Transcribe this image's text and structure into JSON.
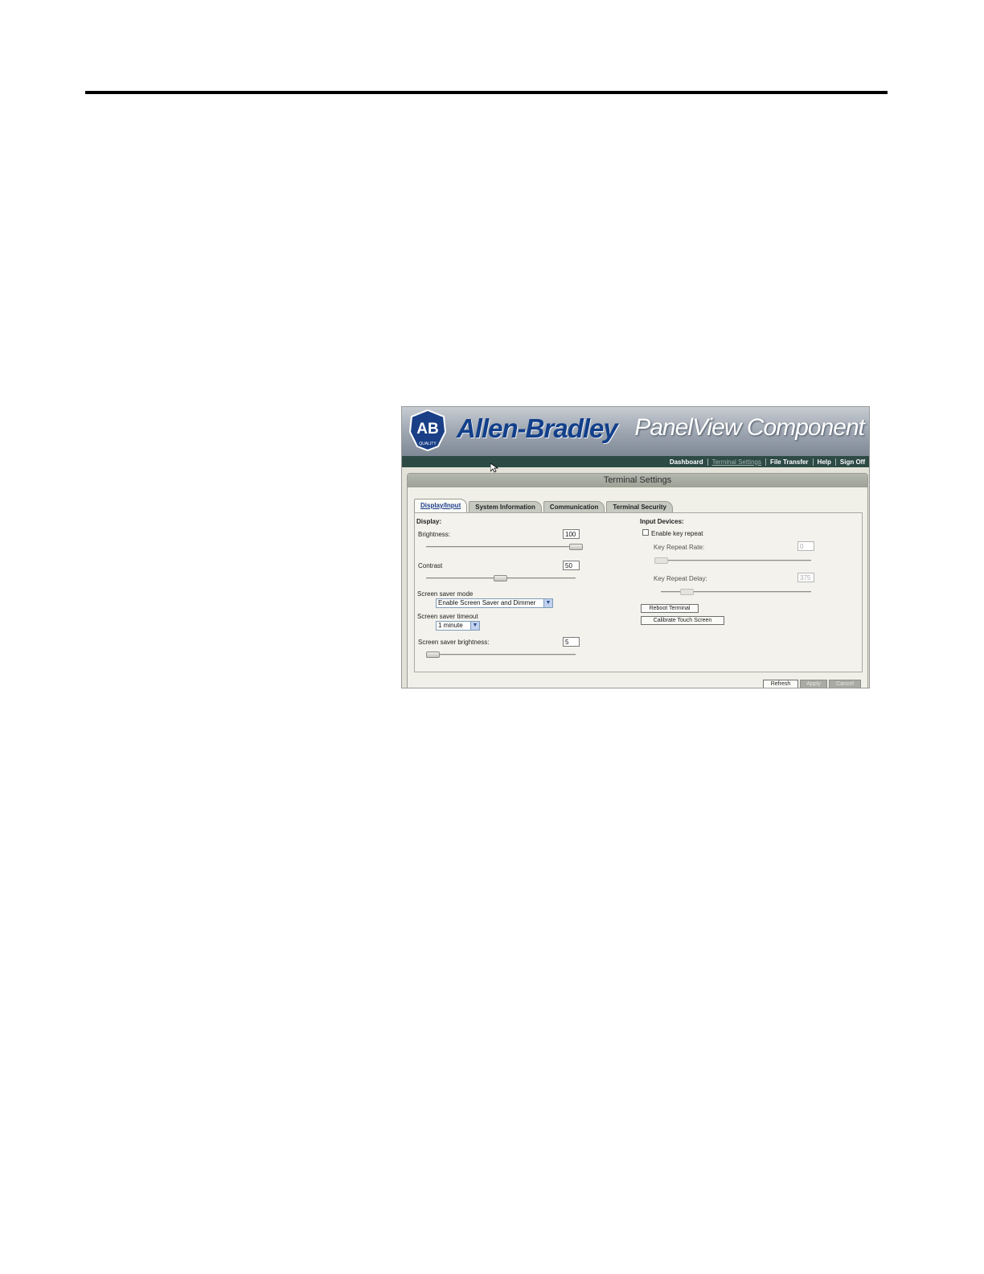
{
  "header": {
    "logo_text": "AB",
    "logo_subtext": "QUALITY",
    "brand": "Allen-Bradley",
    "product": "PanelView Component"
  },
  "nav": {
    "items": [
      {
        "label": "Dashboard"
      },
      {
        "label": "Terminal Settings"
      },
      {
        "label": "File Transfer"
      },
      {
        "label": "Help"
      },
      {
        "label": "Sign Off"
      }
    ]
  },
  "panel": {
    "title": "Terminal Settings",
    "tabs": [
      {
        "label": "Display/Input"
      },
      {
        "label": "System Information"
      },
      {
        "label": "Communication"
      },
      {
        "label": "Terminal Security"
      }
    ]
  },
  "display": {
    "heading": "Display:",
    "brightness": {
      "label": "Brightness:",
      "value": "100",
      "level": 1.0
    },
    "contrast": {
      "label": "Contrast",
      "value": "50",
      "level": 0.5
    },
    "screen_saver_mode": {
      "label": "Screen saver mode",
      "selected": "Enable Screen Saver and Dimmer"
    },
    "screen_saver_timeout": {
      "label": "Screen saver timeout",
      "selected": "1 minute"
    },
    "screen_saver_brightness": {
      "label": "Screen saver brightness:",
      "value": "5",
      "level": 0.0
    }
  },
  "input_devices": {
    "heading": "Input Devices:",
    "enable_key_repeat": {
      "label": "Enable key repeat",
      "checked": false
    },
    "key_repeat_rate": {
      "label": "Key Repeat Rate:",
      "value": "0",
      "level": 0.0
    },
    "key_repeat_delay": {
      "label": "Key Repeat Delay:",
      "value": "375",
      "level": 0.15
    },
    "reboot_label": "Reboot Terminal",
    "calibrate_label": "Calibrate Touch Screen"
  },
  "footer": {
    "refresh_label": "Refresh",
    "apply_label": "Apply",
    "cancel_label": "Cancel"
  },
  "colors": {
    "nav_bg": "#2d4a44",
    "brand_blue": "#123f8a",
    "active_tab_text": "#1f3e8c"
  }
}
